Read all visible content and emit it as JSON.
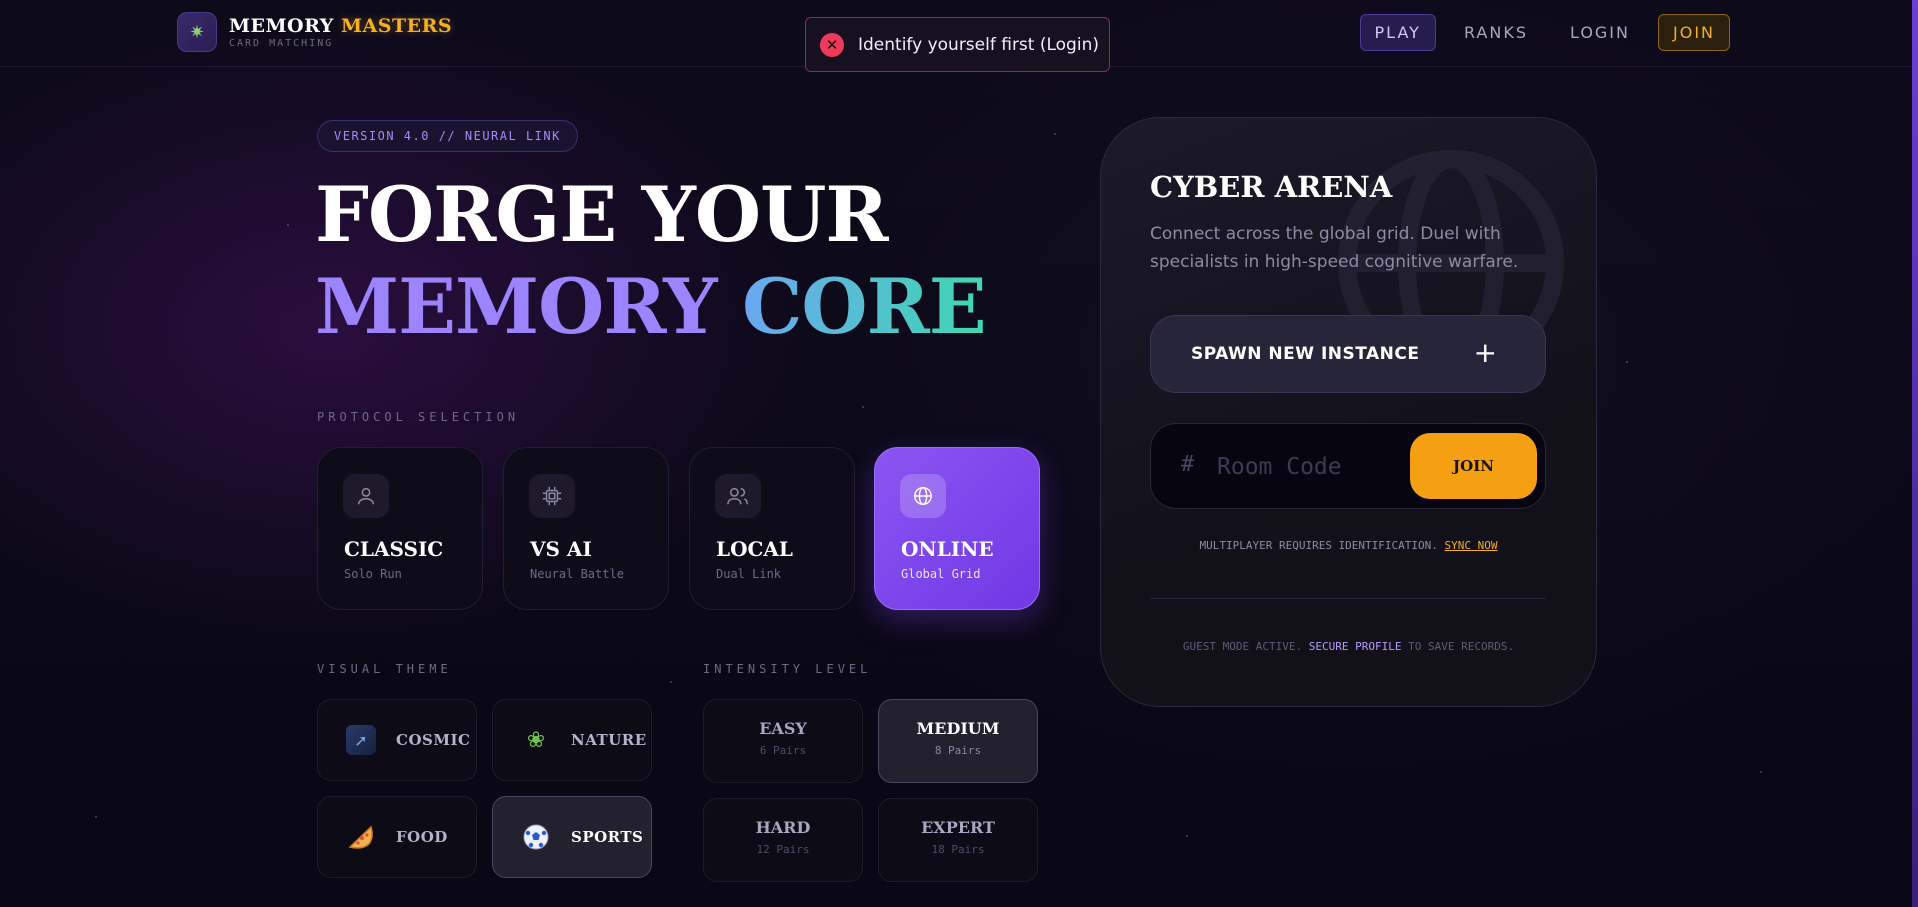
{
  "brand": {
    "title_a": "MEMORY",
    "title_b": "MASTERS",
    "subtitle": "CARD MATCHING",
    "logo_icon": "puzzle-icon"
  },
  "toast": {
    "icon": "close-circle-icon",
    "message": "Identify yourself first (Login)",
    "color": "#ee3b5b"
  },
  "nav": {
    "play": "PLAY",
    "ranks": "RANKS",
    "login": "LOGIN",
    "join": "JOIN"
  },
  "hero": {
    "version": "VERSION 4.0 // NEURAL LINK",
    "line1": "FORGE YOUR",
    "line2_a": "MEMORY",
    "line2_b": "CORE"
  },
  "protocol": {
    "label": "PROTOCOL SELECTION",
    "modes": [
      {
        "title": "CLASSIC",
        "sub": "Solo Run",
        "icon": "user-icon"
      },
      {
        "title": "VS AI",
        "sub": "Neural Battle",
        "icon": "cpu-icon"
      },
      {
        "title": "LOCAL",
        "sub": "Dual Link",
        "icon": "users-icon"
      },
      {
        "title": "ONLINE",
        "sub": "Global Grid",
        "icon": "globe-icon",
        "selected": true
      }
    ]
  },
  "theme": {
    "label": "VISUAL THEME",
    "items": [
      {
        "label": "COSMIC",
        "icon": "comet-icon"
      },
      {
        "label": "NATURE",
        "icon": "herb-icon"
      },
      {
        "label": "FOOD",
        "icon": "pizza-icon"
      },
      {
        "label": "SPORTS",
        "icon": "soccer-ball-icon",
        "selected": true
      }
    ]
  },
  "intensity": {
    "label": "INTENSITY LEVEL",
    "items": [
      {
        "title": "EASY",
        "sub": "6 Pairs"
      },
      {
        "title": "MEDIUM",
        "sub": "8 Pairs",
        "selected": true
      },
      {
        "title": "HARD",
        "sub": "12 Pairs"
      },
      {
        "title": "EXPERT",
        "sub": "18 Pairs"
      }
    ]
  },
  "arena": {
    "title": "CYBER ARENA",
    "description": "Connect across the global grid. Duel with specialists in high-speed cognitive warfare.",
    "spawn_label": "SPAWN NEW INSTANCE",
    "room_placeholder": "Room Code",
    "room_value": "",
    "join_label": "JOIN",
    "mp_note": "MULTIPLAYER REQUIRES IDENTIFICATION.",
    "sync_link": "SYNC NOW",
    "guest_note_a": "GUEST MODE ACTIVE.",
    "secure_link": "SECURE PROFILE",
    "guest_note_b": "TO SAVE RECORDS."
  },
  "colors": {
    "accent_purple": "#8b55f2",
    "accent_gold": "#f5a012",
    "accent_teal": "#3fd8b0"
  }
}
